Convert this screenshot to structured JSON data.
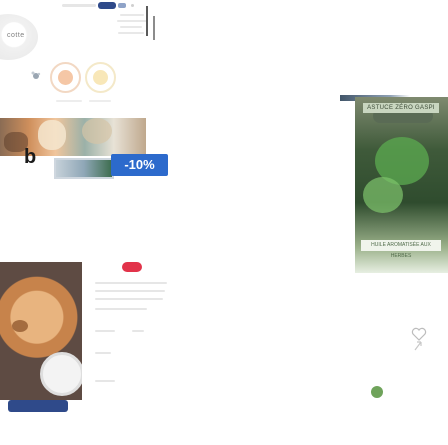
{
  "header": {
    "brand_text": "",
    "pills": [
      "",
      ""
    ]
  },
  "avatar": {
    "label": "cotte"
  },
  "banner": {
    "discount_label": "-10%"
  },
  "jar": {
    "tag": "ASTUCE ZÉRO GASPI",
    "caption": "HUILE AROMATISÉE AUX HERBES"
  },
  "colors": {
    "accent_blue": "#2c6acc",
    "brand_navy": "#2f4a8a",
    "alert_red": "#e2334a",
    "leaf_green": "#6fa35b"
  },
  "icons": {
    "heart": "heart-icon",
    "share": "share-icon",
    "spark": "spark-icon"
  }
}
